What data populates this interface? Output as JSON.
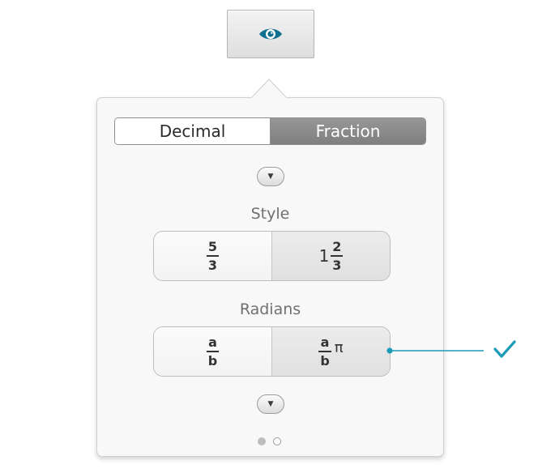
{
  "toolbar": {
    "eye_icon": "eye-icon"
  },
  "display_mode": {
    "options": [
      "Decimal",
      "Fraction"
    ],
    "selected": "Fraction"
  },
  "style": {
    "title": "Style",
    "options": [
      {
        "numerator": "5",
        "denominator": "3"
      },
      {
        "whole": "1",
        "numerator": "2",
        "denominator": "3"
      }
    ],
    "selected_index": 1
  },
  "radians": {
    "title": "Radians",
    "options": [
      {
        "numerator": "a",
        "denominator": "b"
      },
      {
        "numerator": "a",
        "denominator": "b",
        "suffix": "π"
      }
    ],
    "selected_index": 1
  },
  "pager": {
    "pages": 2,
    "current": 1
  },
  "colors": {
    "accent": "#1a9bb8",
    "eye": "#0e6f8e",
    "selected_segment": "#8a8a8a"
  }
}
